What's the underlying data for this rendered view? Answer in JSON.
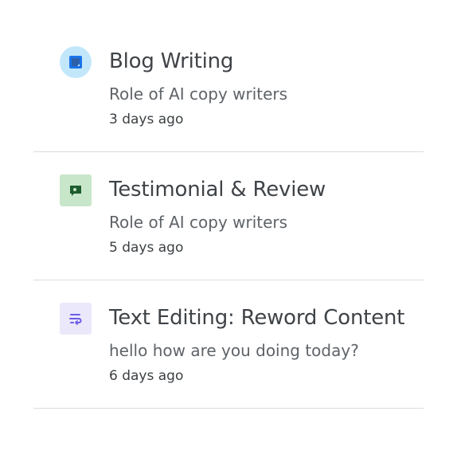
{
  "items": [
    {
      "title": "Blog Writing",
      "subtitle": "Role of AI copy writers",
      "time": "3 days ago",
      "icon": "document-icon",
      "icon_bg": "#c2e7fb",
      "icon_fg": "#1a73e8"
    },
    {
      "title": "Testimonial & Review",
      "subtitle": "Role of AI copy writers",
      "time": "5 days ago",
      "icon": "chat-bubble-icon",
      "icon_bg": "#c8e6c9",
      "icon_fg": "#1e5c2e"
    },
    {
      "title": "Text Editing: Reword Content",
      "subtitle": "hello how are you doing today?",
      "time": "6 days ago",
      "icon": "text-wrap-icon",
      "icon_bg": "#ebe8fb",
      "icon_fg": "#6c5ce7"
    }
  ]
}
